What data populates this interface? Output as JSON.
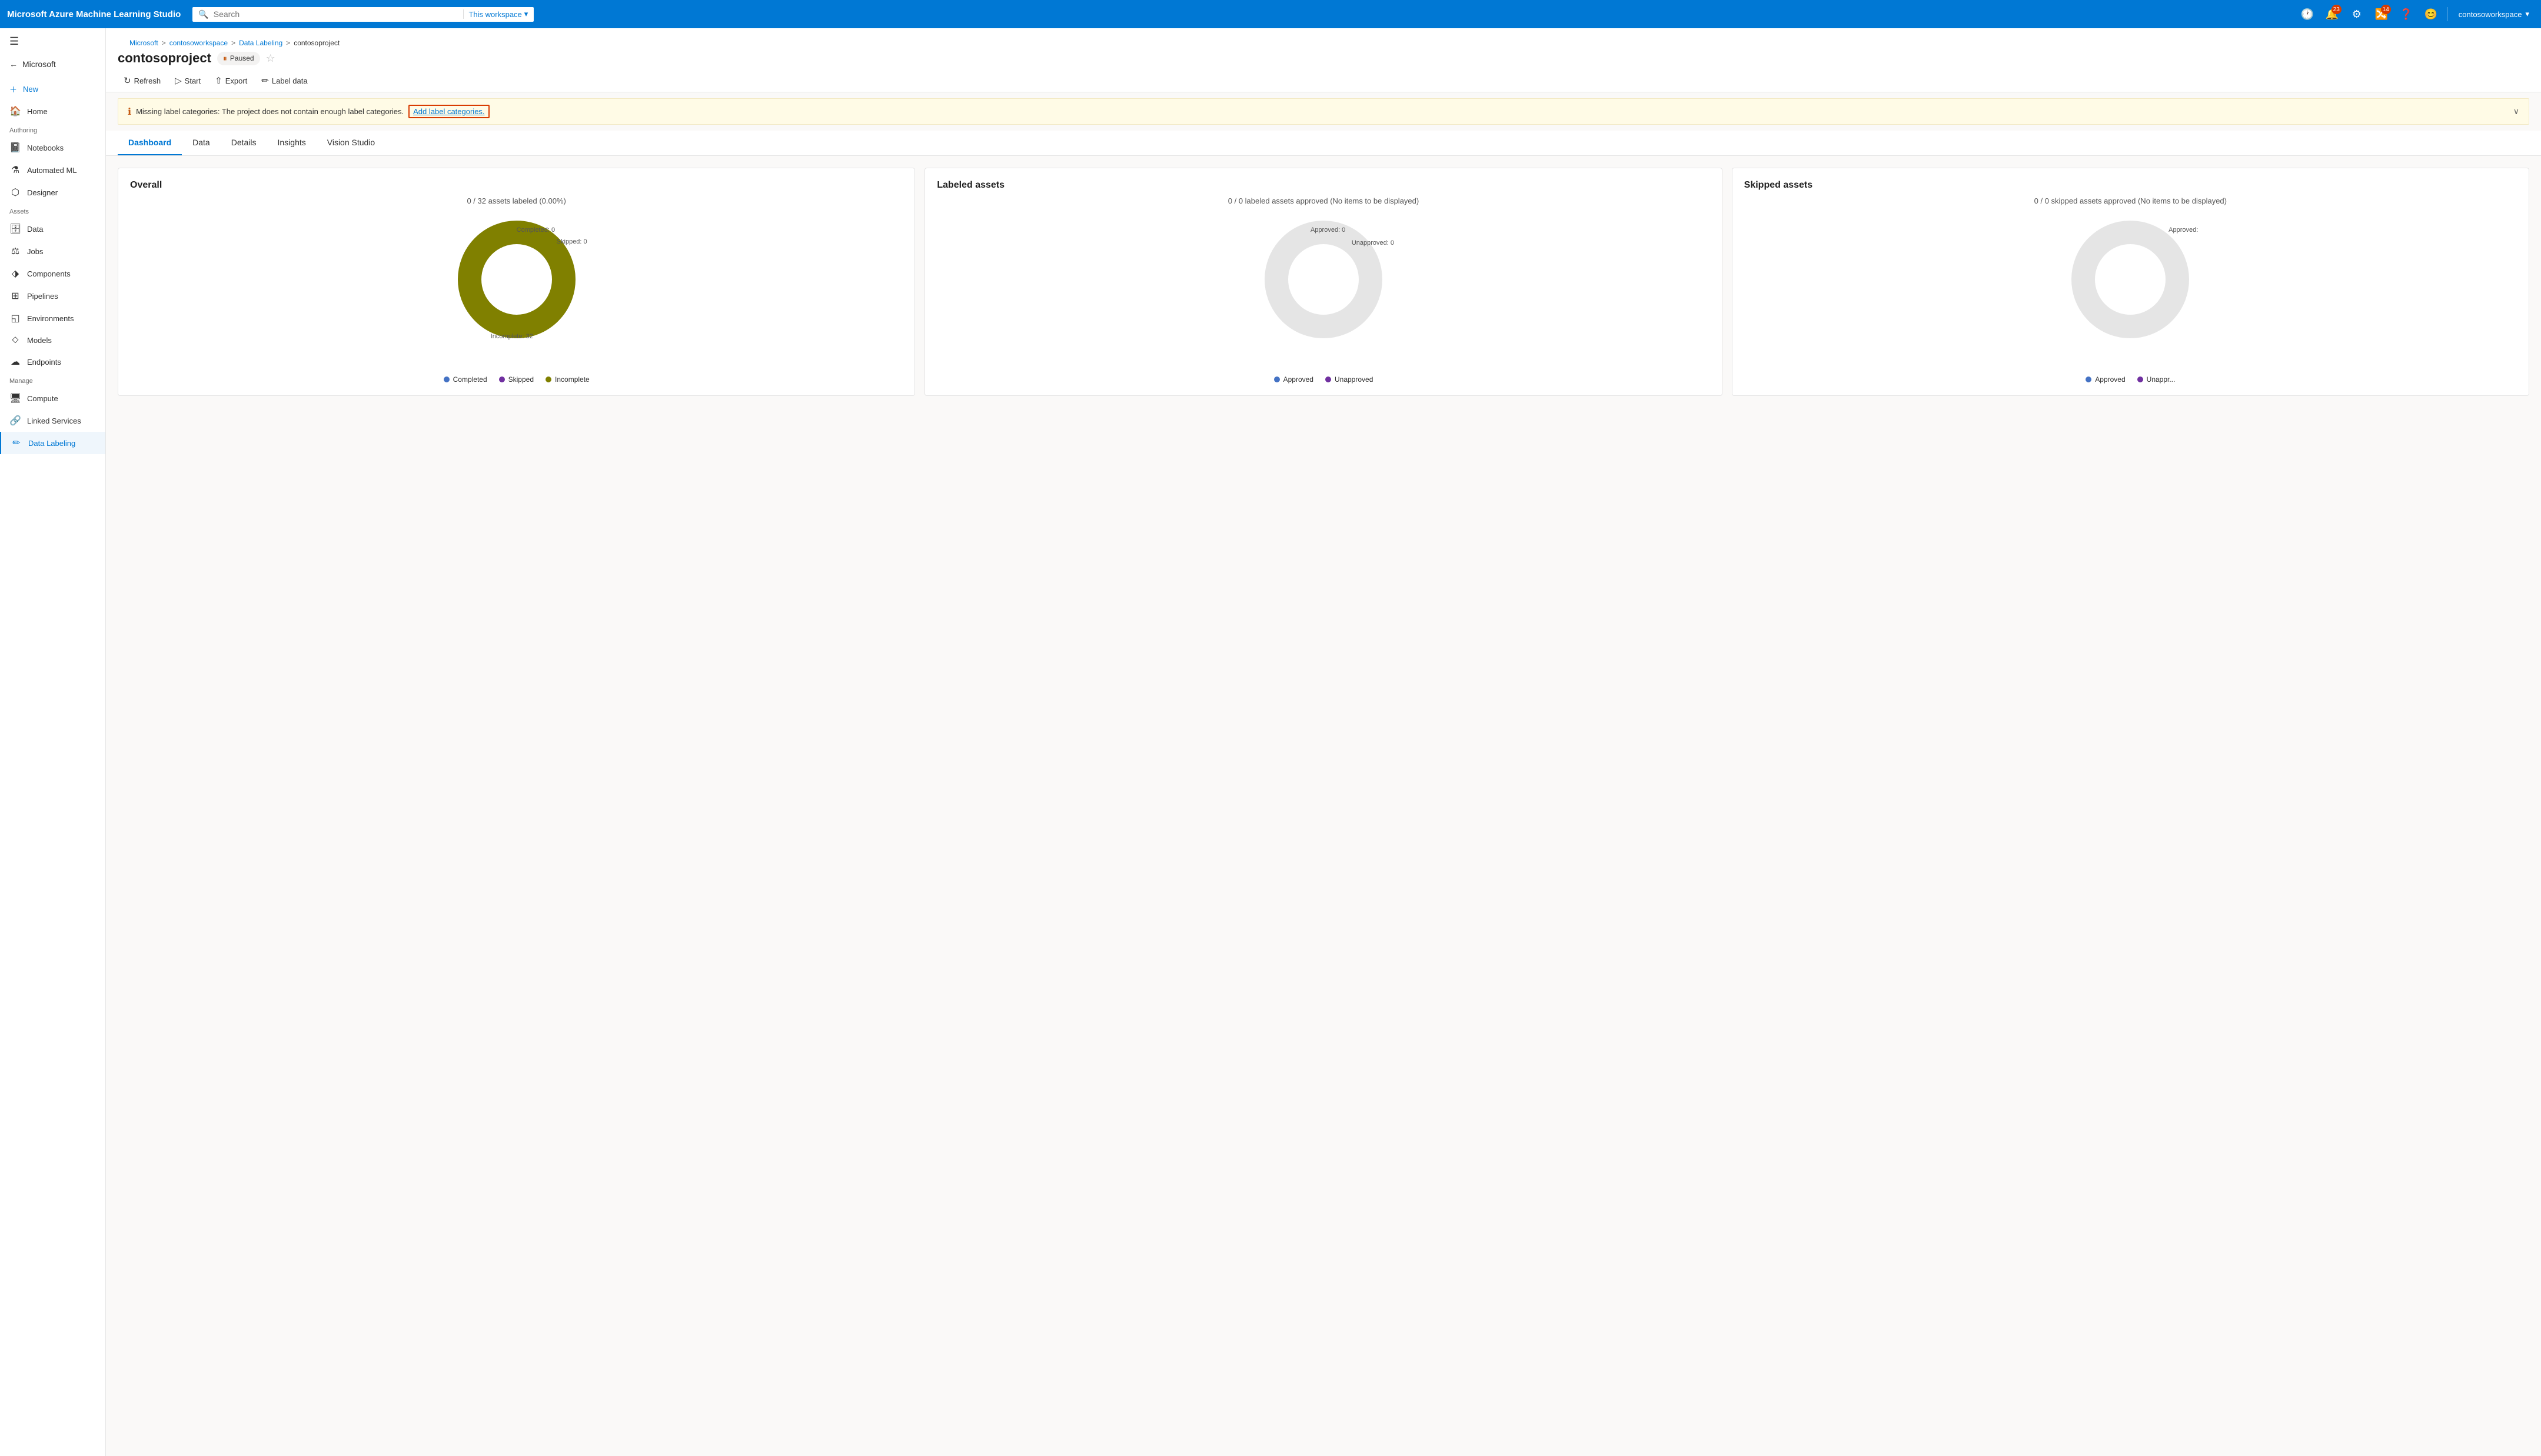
{
  "app": {
    "title": "Microsoft Azure Machine Learning Studio"
  },
  "topnav": {
    "search_placeholder": "Search",
    "workspace_label": "This workspace",
    "notifications_count": "23",
    "updates_count": "14",
    "user_name": "contosoworkspace"
  },
  "breadcrumb": {
    "items": [
      "Microsoft",
      "contosoworkspace",
      "Data Labeling",
      "contosoproject"
    ]
  },
  "page": {
    "title": "contosoproject",
    "status": "Paused"
  },
  "toolbar": {
    "refresh": "Refresh",
    "start": "Start",
    "export": "Export",
    "label_data": "Label data"
  },
  "warning": {
    "text": "Missing label categories: The project does not contain enough label categories.",
    "link": "Add label categories."
  },
  "tabs": {
    "items": [
      "Dashboard",
      "Data",
      "Details",
      "Insights",
      "Vision Studio"
    ],
    "active": "Dashboard"
  },
  "sidebar": {
    "microsoft": "Microsoft",
    "new_label": "New",
    "home_label": "Home",
    "authoring_label": "Authoring",
    "notebooks_label": "Notebooks",
    "automl_label": "Automated ML",
    "designer_label": "Designer",
    "assets_label": "Assets",
    "data_label": "Data",
    "jobs_label": "Jobs",
    "components_label": "Components",
    "pipelines_label": "Pipelines",
    "environments_label": "Environments",
    "models_label": "Models",
    "endpoints_label": "Endpoints",
    "manage_label": "Manage",
    "compute_label": "Compute",
    "linked_services_label": "Linked Services",
    "data_labeling_label": "Data Labeling"
  },
  "overall_card": {
    "title": "Overall",
    "subtitle": "0 / 32 assets labeled (0.00%)",
    "completed_label": "Completed: 0",
    "skipped_label": "Skipped: 0",
    "incomplete_label": "Incomplete: 32",
    "legend": {
      "completed": "Completed",
      "skipped": "Skipped",
      "incomplete": "Incomplete"
    },
    "colors": {
      "completed": "#4472c4",
      "skipped": "#7030a0",
      "incomplete": "#808000"
    },
    "chart": {
      "incomplete_pct": 100,
      "completed_pct": 0,
      "skipped_pct": 0
    }
  },
  "labeled_card": {
    "title": "Labeled assets",
    "subtitle": "0 / 0 labeled assets approved (No items to be displayed)",
    "approved_label": "Approved: 0",
    "unapproved_label": "Unapproved: 0",
    "legend": {
      "approved": "Approved",
      "unapproved": "Unapproved"
    },
    "colors": {
      "approved": "#4472c4",
      "unapproved": "#7030a0"
    }
  },
  "skipped_card": {
    "title": "Skipped assets",
    "subtitle": "0 / 0 skipped assets approved (No items to be displayed)",
    "approved_label": "Approved:",
    "legend": {
      "approved": "Approved",
      "unapproved": "Unappr..."
    },
    "colors": {
      "approved": "#4472c4",
      "unapproved": "#7030a0"
    }
  }
}
